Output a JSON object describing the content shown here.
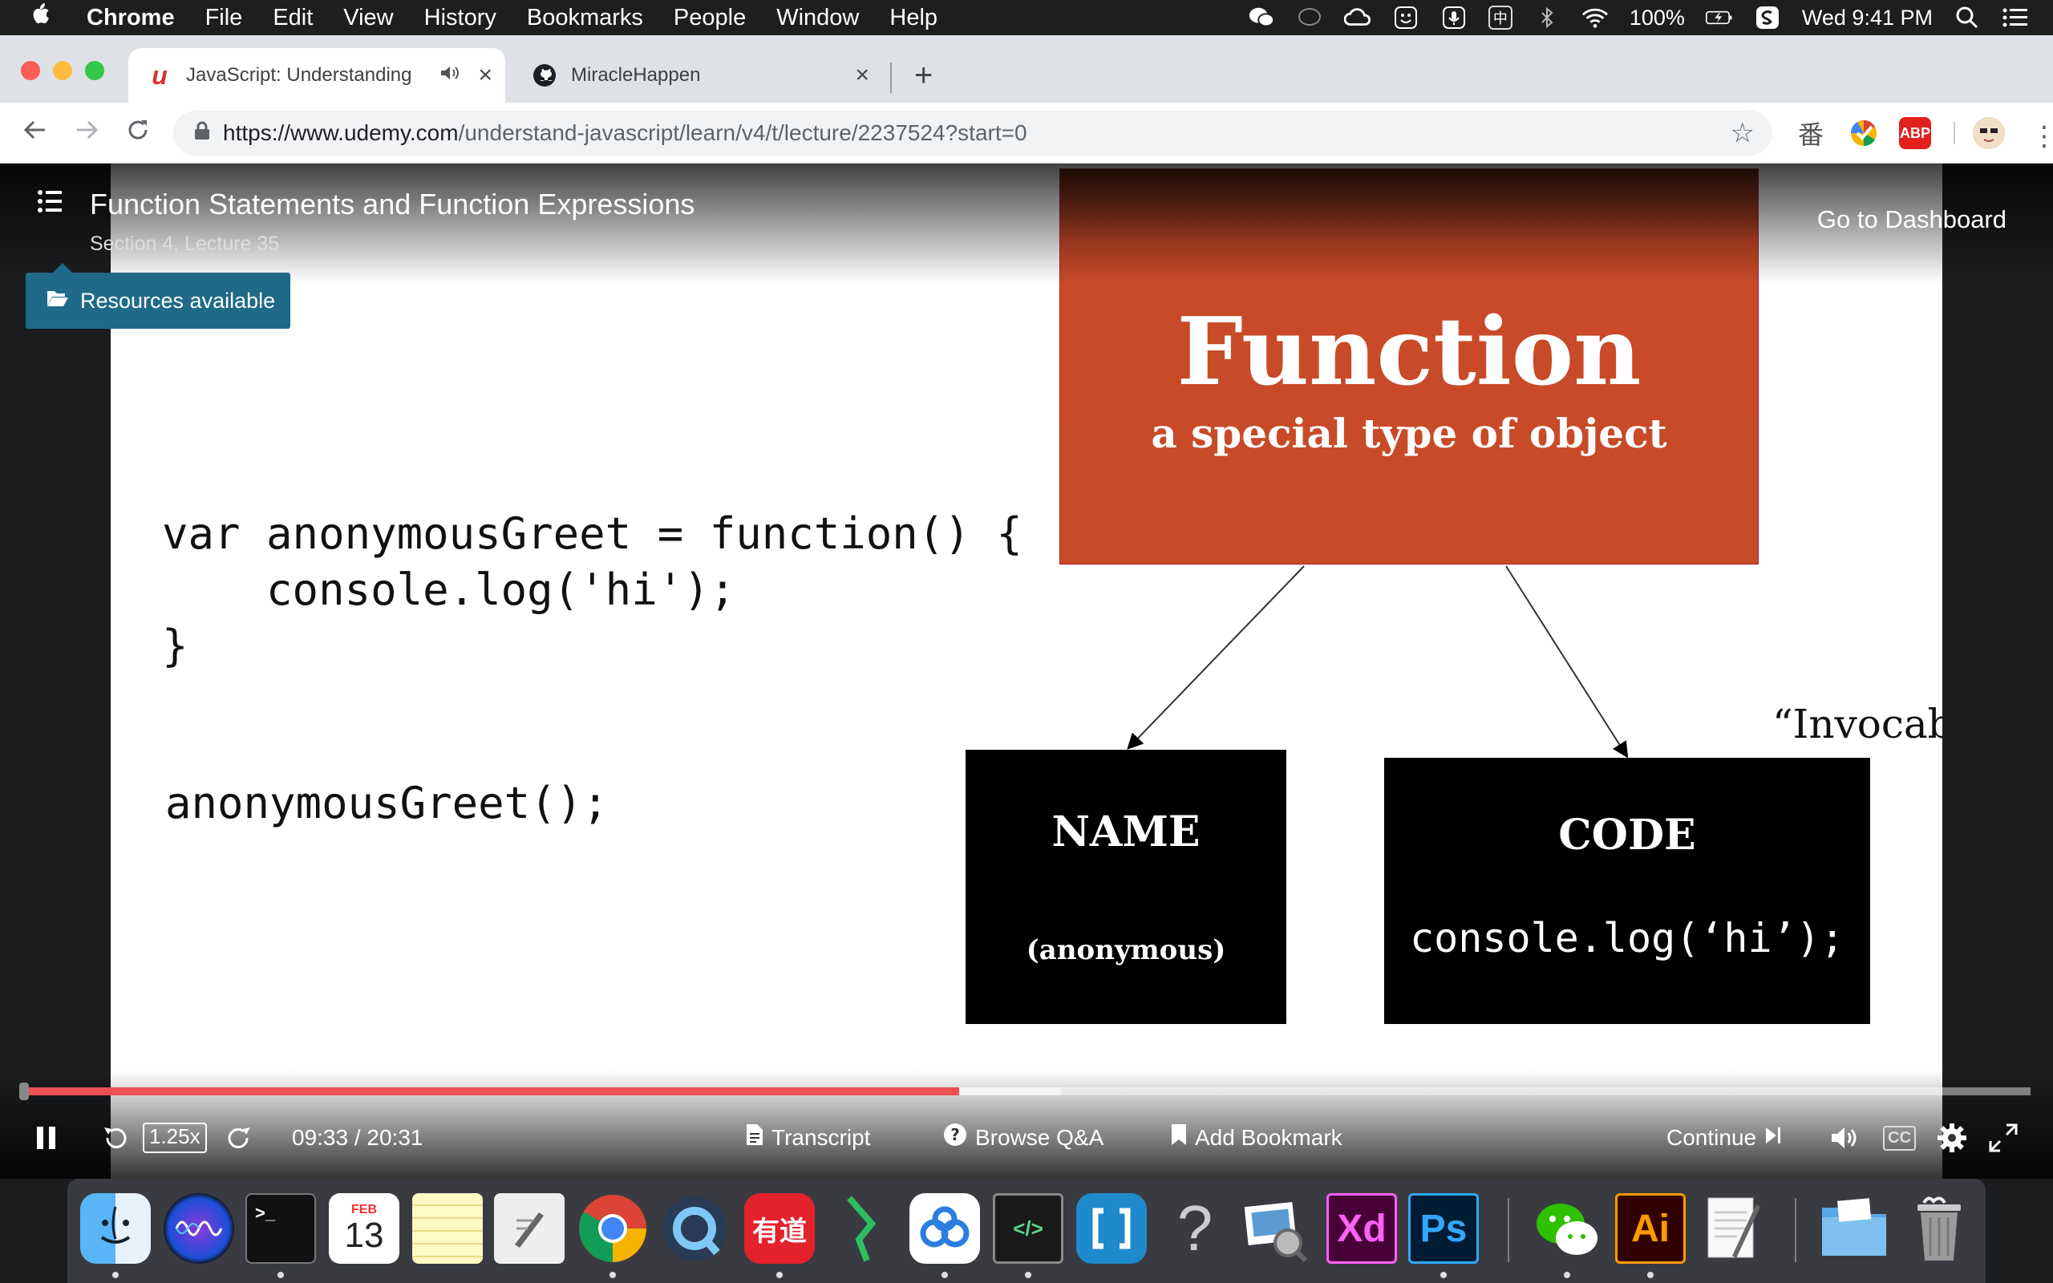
{
  "menubar": {
    "items": [
      "Chrome",
      "File",
      "Edit",
      "View",
      "History",
      "Bookmarks",
      "People",
      "Window",
      "Help"
    ],
    "battery": "100%",
    "clock": "Wed 9:41 PM",
    "input_method": "中"
  },
  "tabs": [
    {
      "title": "JavaScript: Understanding",
      "favicon": "udemy-logo",
      "favicon_glyph": "u",
      "active": true
    },
    {
      "title": "MiracleHappen",
      "favicon": "github-logo",
      "active": false
    }
  ],
  "toolbar": {
    "url_host": "https://www.udemy.com",
    "url_path": "/understand-javascript/learn/v4/t/lecture/2237524?start=0",
    "ext_abp": "ABP",
    "ext_translate": "番"
  },
  "lecture": {
    "title": "Function Statements and Function Expressions",
    "subtitle": "Section 4, Lecture 35",
    "dashboard_label": "Go to Dashboard",
    "resources_label": "Resources available"
  },
  "slide": {
    "code_line1": "var anonymousGreet = function() {",
    "code_line2": "    console.log('hi');",
    "code_line3": "}",
    "code_call": "anonymousGreet();",
    "box_title": "Function",
    "box_subtitle": "a special type of object",
    "name_title": "NAME",
    "name_value": "(anonymous)",
    "code_title": "CODE",
    "code_value": "console.log(‘hi’);",
    "invocable_text": "“Invocab"
  },
  "player": {
    "time": "09:33 / 20:31",
    "speed": "1.25x",
    "progress": 0.4666,
    "buffered": 0.5172,
    "transcript_label": "Transcript",
    "qa_label": "Browse Q&A",
    "bookmark_label": "Add Bookmark",
    "continue_label": "Continue",
    "cc_label": "CC"
  },
  "dock": {
    "apps": [
      "Finder",
      "Siri",
      "Terminal",
      "Calendar",
      "Notes",
      "Script Editor",
      "Chrome",
      "QuickTime",
      "Youdao",
      "Evernote",
      "Baidu Netdisk",
      "Code Editor",
      "Brackets",
      "Help",
      "Preview",
      "Adobe XD",
      "Photoshop",
      "WeChat",
      "Illustrator",
      "TextEdit",
      "Downloads",
      "Trash"
    ],
    "calendar_month": "FEB",
    "calendar_day": "13",
    "youdao_label": "有道",
    "xd_label": "Xd",
    "ps_label": "Ps",
    "ai_label": "Ai",
    "code_label": "</>",
    "help_label": "?"
  }
}
